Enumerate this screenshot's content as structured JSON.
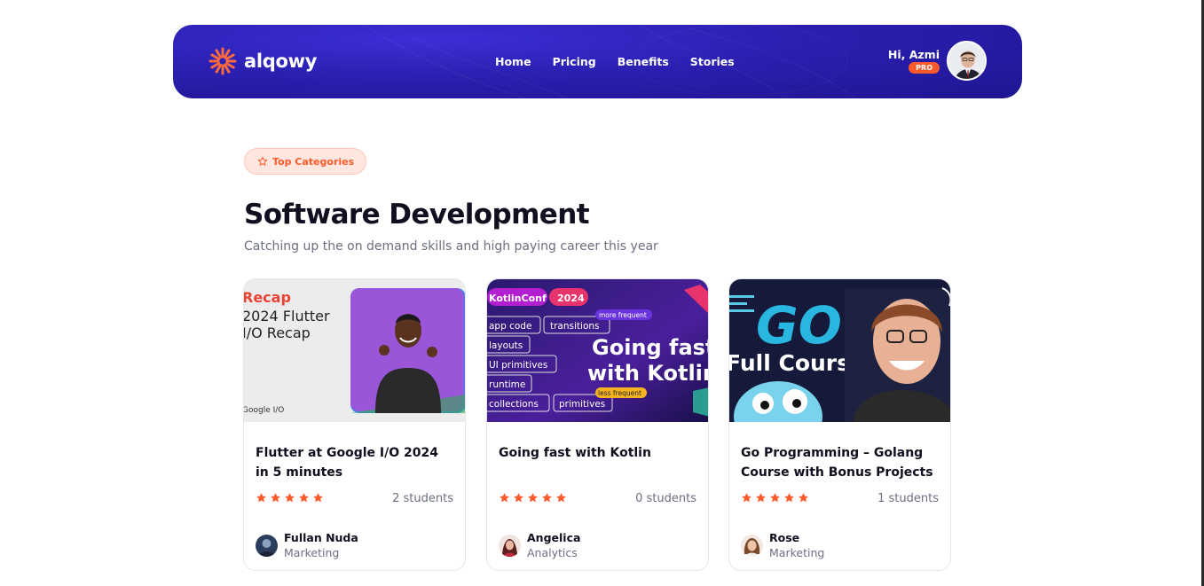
{
  "header": {
    "logo_text": "alqowy",
    "nav": [
      "Home",
      "Pricing",
      "Benefits",
      "Stories"
    ],
    "user_greeting": "Hi, Azmi",
    "user_badge": "PRO"
  },
  "section": {
    "badge_label": "Top Categories",
    "title": "Software Development",
    "subtitle": "Catching up the on demand skills and high paying career this year"
  },
  "courses": [
    {
      "title": "Flutter at Google I/O 2024 in 5 minutes",
      "rating": 5,
      "students": "2 students",
      "mentor_name": "Fullan Nuda",
      "mentor_role": "Marketing",
      "thumb": {
        "line1": "Recap",
        "line2": "2024 Flutter",
        "line3": "I/O Recap",
        "footer": "Google I/O"
      }
    },
    {
      "title": "Going fast with Kotlin",
      "rating": 5,
      "students": "0 students",
      "mentor_name": "Angelica",
      "mentor_role": "Analytics",
      "thumb": {
        "tag1": "KotlinConf",
        "tag2": "2024",
        "chips": [
          "app code",
          "transitions",
          "layouts",
          "UI primitives",
          "runtime",
          "collections",
          "primitives"
        ],
        "more": "more frequent",
        "less": "less frequent",
        "headline1": "Going fast",
        "headline2": "with Kotlin"
      }
    },
    {
      "title": "Go Programming – Golang Course with Bonus Projects",
      "rating": 5,
      "students": "1 students",
      "mentor_name": "Rose",
      "mentor_role": "Marketing",
      "thumb": {
        "headline1": "GO",
        "headline2": "Full Course"
      }
    }
  ],
  "colors": {
    "accent": "#ff5a2c",
    "header": "#2a1fb0",
    "text": "#0f0f1f",
    "muted": "#6b6f80"
  }
}
